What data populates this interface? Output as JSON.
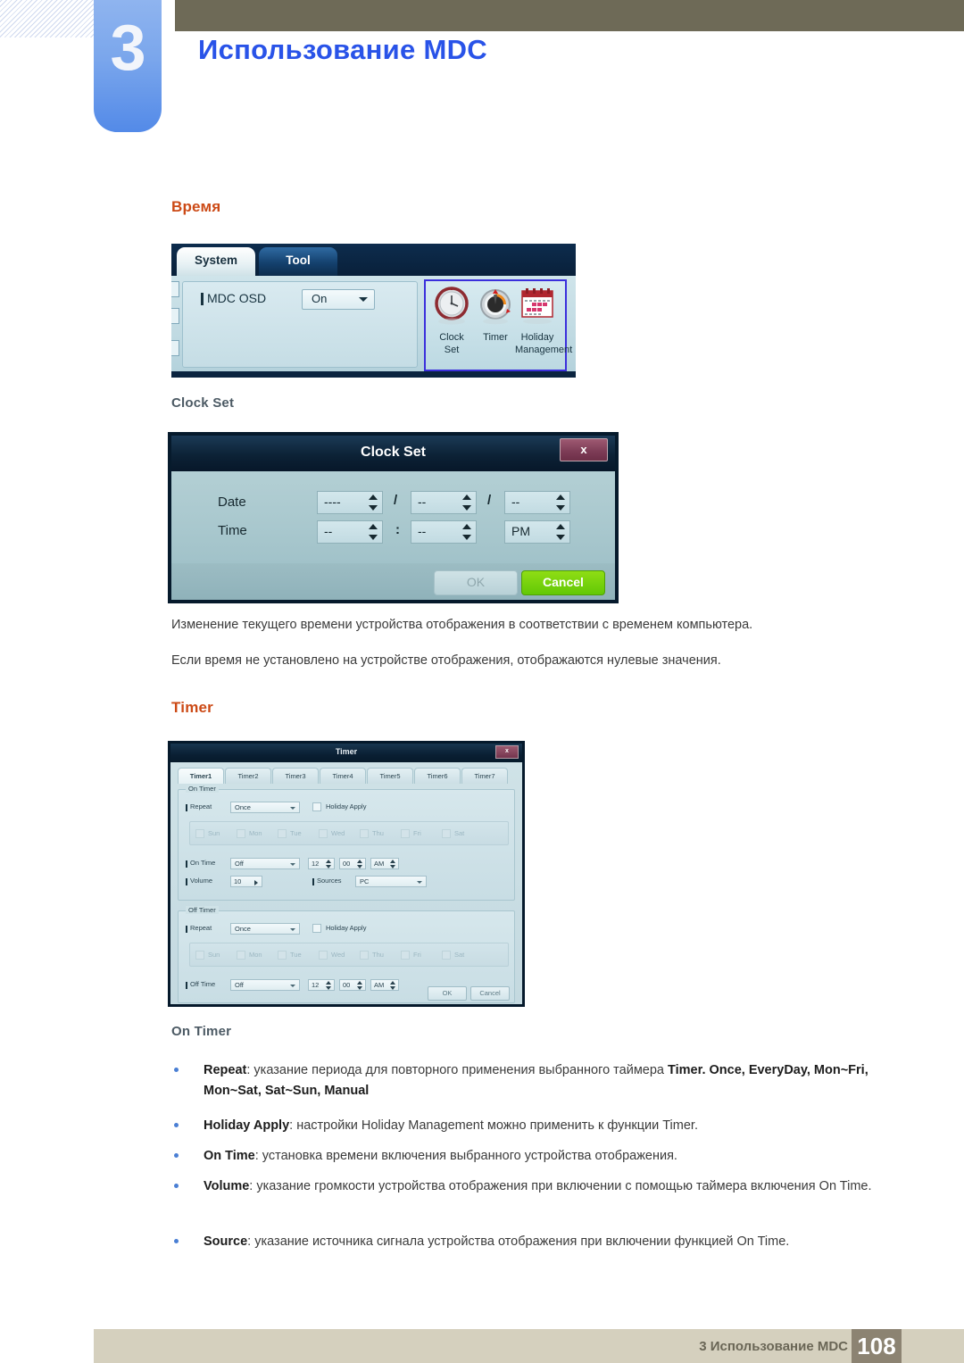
{
  "header": {
    "chapter_number": "3",
    "title": "Использование MDC"
  },
  "sections": {
    "time_heading": "Время",
    "clock_set_subheading": "Clock Set",
    "clock_set_para_1": "Изменение текущего времени устройства отображения в соответствии с временем компьютера.",
    "clock_set_para_2": "Если время не установлено на устройстве отображения, отображаются нулевые значения.",
    "timer_heading": "Timer",
    "on_timer_subheading": "On Timer"
  },
  "system_tool_panel": {
    "tabs": [
      {
        "label": "System",
        "active": true
      },
      {
        "label": "Tool",
        "active": false
      }
    ],
    "mdc_osd": {
      "label": "MDC OSD",
      "value": "On"
    },
    "icons": [
      {
        "name": "clock-set-icon",
        "caption_line1": "Clock",
        "caption_line2": "Set"
      },
      {
        "name": "timer-icon",
        "caption_line1": "Timer",
        "caption_line2": ""
      },
      {
        "name": "holiday-management-icon",
        "caption_line1": "Holiday",
        "caption_line2": "Management"
      }
    ],
    "highlight_color": "#3b2fdc"
  },
  "clock_set_dialog": {
    "title": "Clock Set",
    "close_label": "x",
    "date_label": "Date",
    "time_label": "Time",
    "date_year": "----",
    "date_month": "--",
    "date_day": "--",
    "time_hour": "--",
    "time_minute": "--",
    "time_meridiem": "PM",
    "date_separator": "/",
    "time_separator": ":",
    "ok_label": "OK",
    "cancel_label": "Cancel",
    "cancel_color": "#62c806"
  },
  "timer_dialog": {
    "title": "Timer",
    "close_label": "x",
    "tabs": [
      "Timer1",
      "Timer2",
      "Timer3",
      "Timer4",
      "Timer5",
      "Timer6",
      "Timer7"
    ],
    "active_tab": "Timer1",
    "on_timer": {
      "legend": "On Timer",
      "repeat_label": "Repeat",
      "repeat_value": "Once",
      "holiday_apply_label": "Holiday Apply",
      "days": [
        "Sun",
        "Mon",
        "Tue",
        "Wed",
        "Thu",
        "Fri",
        "Sat"
      ],
      "on_time_label": "On Time",
      "on_time_value": "Off",
      "on_time_hour": "12",
      "on_time_minute": "00",
      "on_time_meridiem": "AM",
      "volume_label": "Volume",
      "volume_value": "10",
      "sources_label": "Sources",
      "sources_value": "PC"
    },
    "off_timer": {
      "legend": "Off Timer",
      "repeat_label": "Repeat",
      "repeat_value": "Once",
      "holiday_apply_label": "Holiday Apply",
      "days": [
        "Sun",
        "Mon",
        "Tue",
        "Wed",
        "Thu",
        "Fri",
        "Sat"
      ],
      "off_time_label": "Off Time",
      "off_time_value": "Off",
      "off_time_hour": "12",
      "off_time_minute": "00",
      "off_time_meridiem": "AM"
    },
    "ok_label": "OK",
    "cancel_label": "Cancel"
  },
  "bullets": [
    {
      "term": "Repeat",
      "text": ": указание периода для повторного применения выбранного таймера ",
      "bold_tail": "Timer. Once, EveryDay, Mon~Fri, Mon~Sat, Sat~Sun, Manual"
    },
    {
      "term": "Holiday Apply",
      "text": ": настройки Holiday Management можно применить к функции  Timer."
    },
    {
      "term": "On Time",
      "text": ": установка времени включения выбранного устройства отображения."
    },
    {
      "term": "Volume",
      "text": ": указание громкости устройства отображения при включении с помощью таймера включения On Time."
    },
    {
      "term": "Source",
      "text": ": указание источника сигнала устройства отображения при включении функцией On Time."
    }
  ],
  "footer": {
    "text": "3 Использование MDC",
    "page_number": "108"
  }
}
